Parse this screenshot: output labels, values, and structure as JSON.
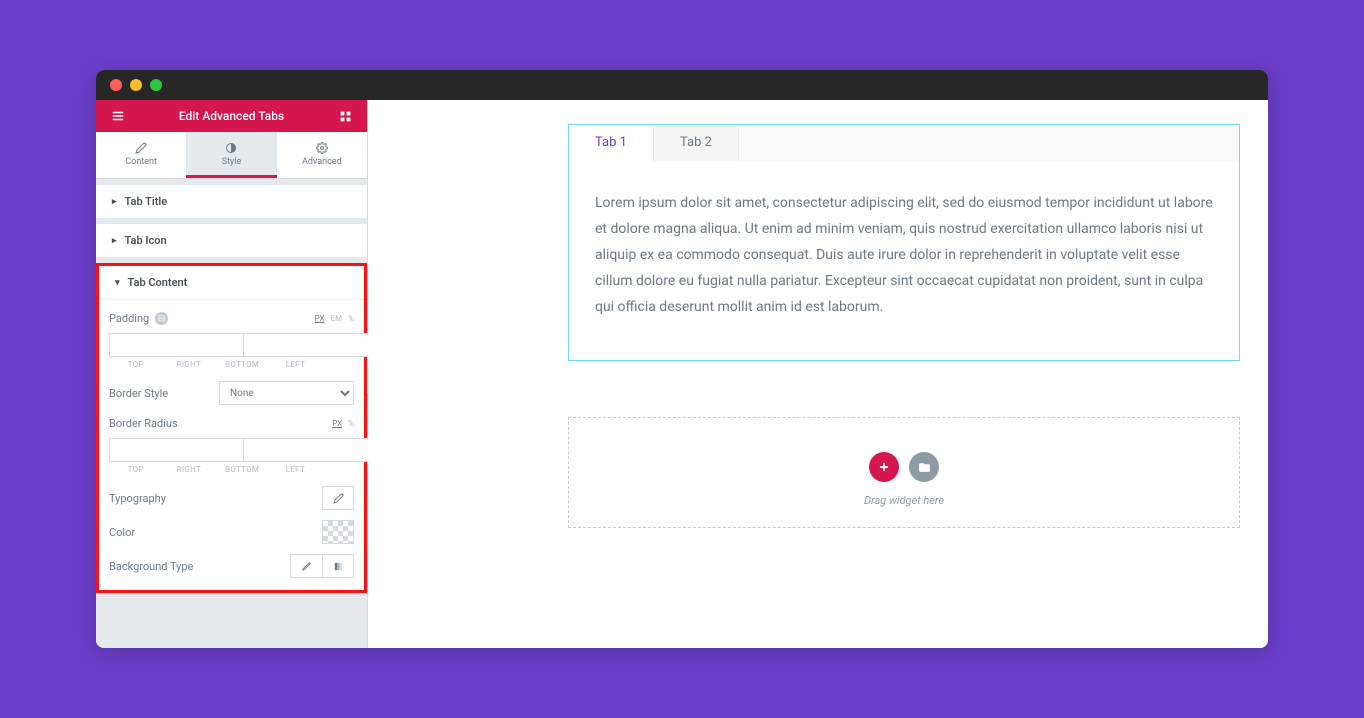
{
  "sidebar": {
    "title": "Edit Advanced Tabs",
    "tabs": [
      {
        "label": "Content"
      },
      {
        "label": "Style"
      },
      {
        "label": "Advanced"
      }
    ],
    "sections": {
      "tab_title": "Tab Title",
      "tab_icon": "Tab Icon",
      "tab_content": "Tab Content"
    },
    "controls": {
      "padding_label": "Padding",
      "border_style_label": "Border Style",
      "border_style_value": "None",
      "border_radius_label": "Border Radius",
      "typography_label": "Typography",
      "color_label": "Color",
      "background_type_label": "Background Type"
    },
    "units": {
      "px": "PX",
      "em": "EM",
      "pct": "%"
    },
    "dim_labels": {
      "top": "TOP",
      "right": "RIGHT",
      "bottom": "BOTTOM",
      "left": "LEFT"
    }
  },
  "canvas": {
    "tabs": [
      {
        "label": "Tab 1"
      },
      {
        "label": "Tab 2"
      }
    ],
    "content": "Lorem ipsum dolor sit amet, consectetur adipiscing elit, sed do eiusmod tempor incididunt ut labore et dolore magna aliqua. Ut enim ad minim veniam, quis nostrud exercitation ullamco laboris nisi ut aliquip ex ea commodo consequat. Duis aute irure dolor in reprehenderit in voluptate velit esse cillum dolore eu fugiat nulla pariatur. Excepteur sint occaecat cupidatat non proident, sunt in culpa qui officia deserunt mollit anim id est laborum.",
    "dropzone_text": "Drag widget here"
  }
}
